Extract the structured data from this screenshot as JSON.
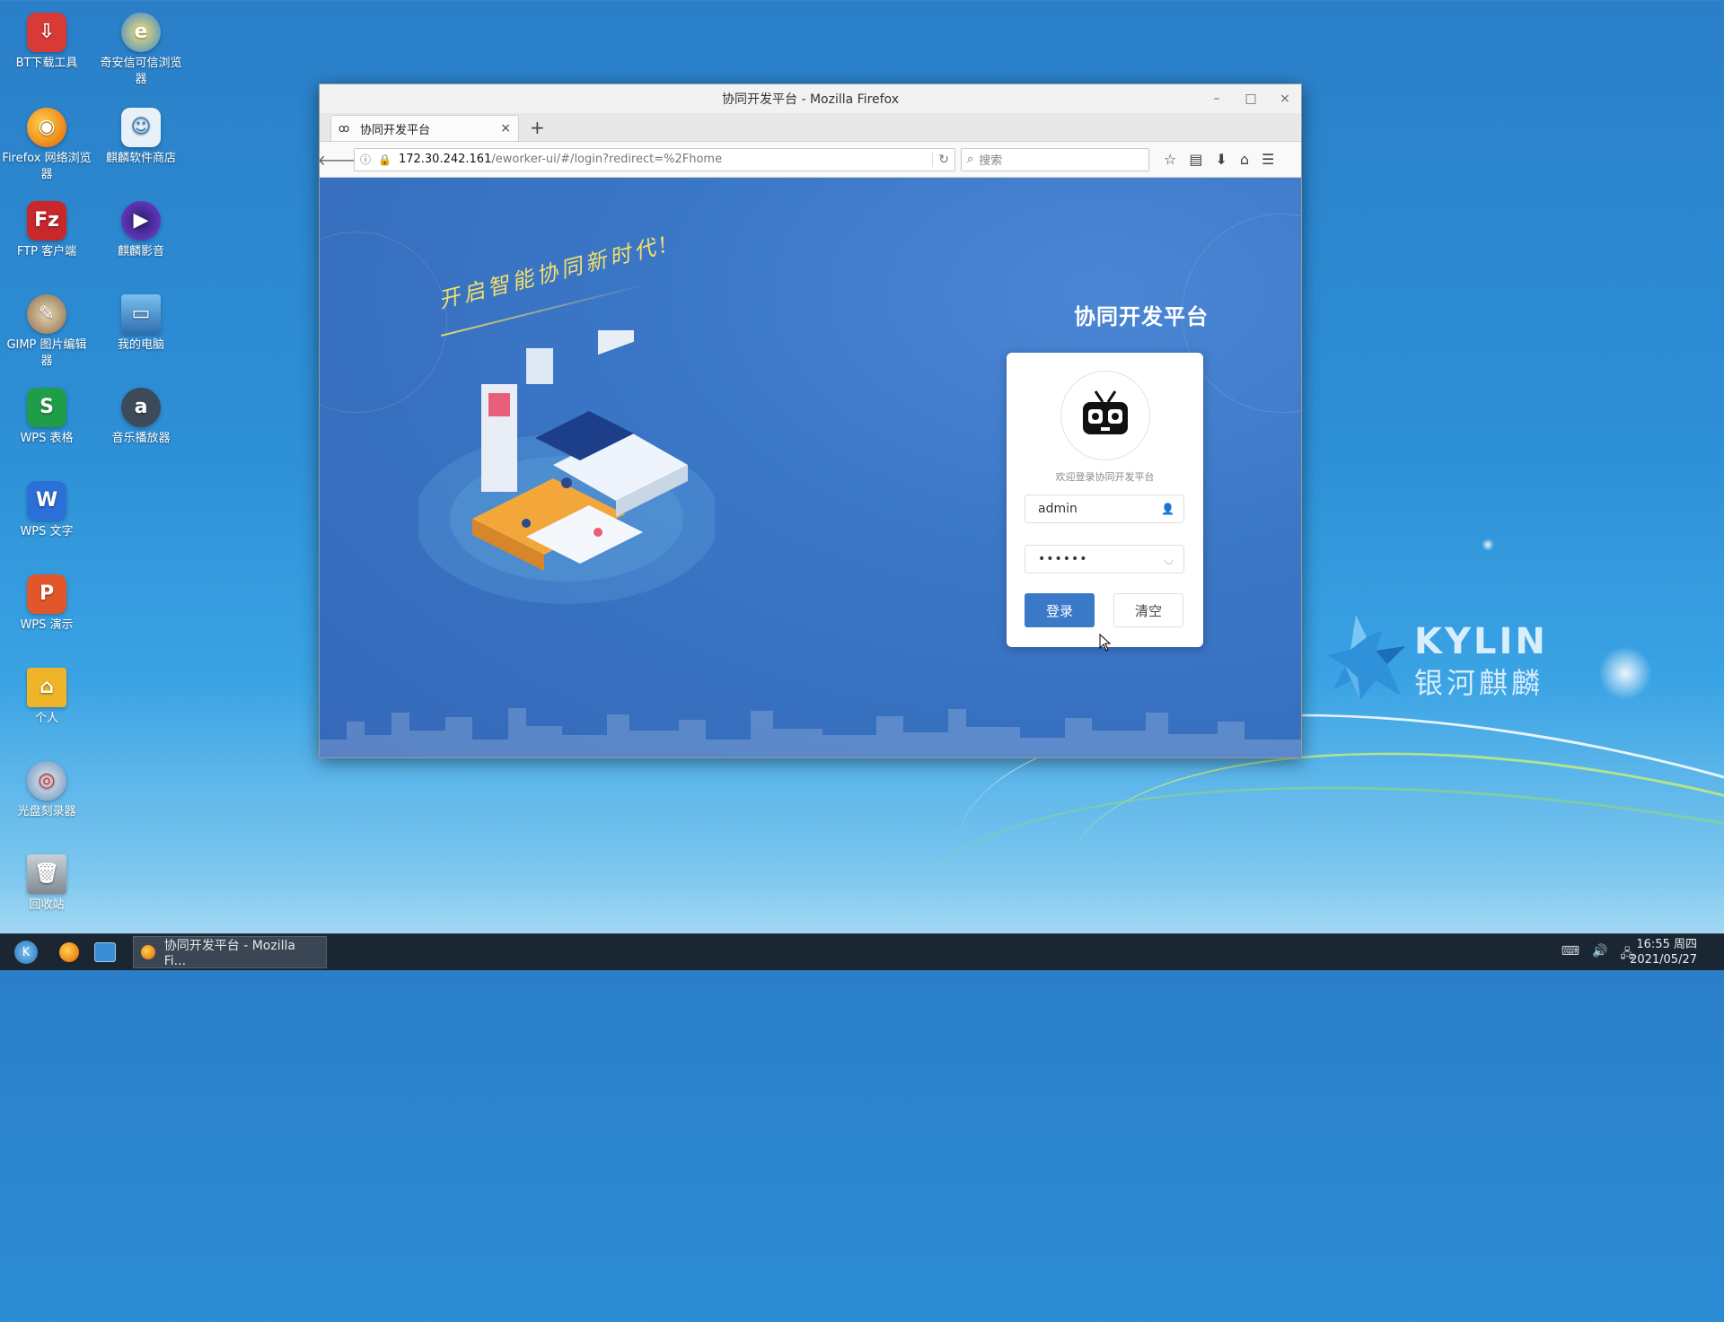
{
  "desktop": {
    "icons": [
      {
        "label": "BT下载工具",
        "icon": "download-arrow-icon",
        "color": "#d93a36"
      },
      {
        "label": "奇安信可信浏览器",
        "icon": "qianxin-browser-icon",
        "color": "#f3b21a"
      },
      {
        "label": "Firefox 网络浏览器",
        "icon": "firefox-icon",
        "color": "#f07a1d"
      },
      {
        "label": "麒麟软件商店",
        "icon": "store-bag-icon",
        "color": "#cfe2f0"
      },
      {
        "label": "FTP 客户端",
        "icon": "filezilla-icon",
        "color": "#c8282a"
      },
      {
        "label": "麒麟影音",
        "icon": "play-icon",
        "color": "#6a2fd0"
      },
      {
        "label": "GIMP 图片编辑器",
        "icon": "gimp-icon",
        "color": "#a89070"
      },
      {
        "label": "我的电脑",
        "icon": "computer-monitor-icon",
        "color": "#4a90c8"
      },
      {
        "label": "WPS 表格",
        "icon": "wps-sheet-icon",
        "color": "#1f9e4a"
      },
      {
        "label": "音乐播放器",
        "icon": "music-player-icon",
        "color": "#3d4a5a"
      },
      {
        "label": "WPS 文字",
        "icon": "wps-writer-icon",
        "color": "#2b6fd8"
      },
      {
        "label": "WPS 演示",
        "icon": "wps-presentation-icon",
        "color": "#e2572a"
      },
      {
        "label": "个人",
        "icon": "home-folder-icon",
        "color": "#f0b429"
      },
      {
        "label": "光盘刻录器",
        "icon": "disc-burner-icon",
        "color": "#5a7fa8"
      },
      {
        "label": "回收站",
        "icon": "trash-icon",
        "color": "#9aa4ae"
      }
    ],
    "brand": {
      "en": "KYLIN",
      "cn": "银河麒麟"
    }
  },
  "window": {
    "title": "协同开发平台 - Mozilla Firefox",
    "controls": {
      "minimize": "–",
      "maximize": "□",
      "close": "×"
    },
    "tab": {
      "title": "协同开发平台",
      "close": "×"
    },
    "new_tab": "+",
    "url": {
      "host": "172.30.242.161",
      "path": "/eworker-ui/#/login?redirect=%2Fhome"
    },
    "search_placeholder": "搜索"
  },
  "page": {
    "slogan": "开启智能协同新时代!",
    "login_title": "协同开发平台",
    "welcome": "欢迎登录协同开发平台",
    "username": "admin",
    "password_mask": "••••••",
    "login_button": "登录",
    "clear_button": "清空",
    "accent": "#3a78c8"
  },
  "taskbar": {
    "task_label": "协同开发平台 - Mozilla Fi...",
    "time": "16:55 周四",
    "date": "2021/05/27"
  }
}
